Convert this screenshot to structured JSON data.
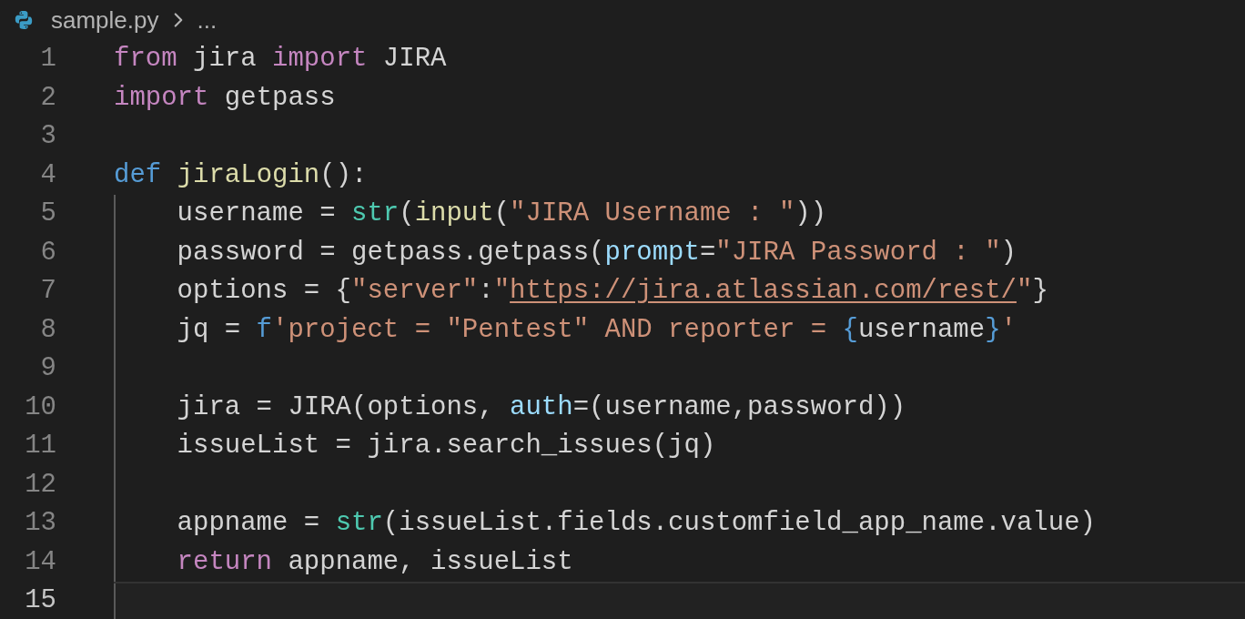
{
  "breadcrumb": {
    "file": "sample.py",
    "more": "..."
  },
  "lines": [
    {
      "number": "1",
      "indented": false,
      "current": false,
      "tokens": [
        {
          "kind": "keyword",
          "text": "from"
        },
        {
          "kind": "plain",
          "text": " jira "
        },
        {
          "kind": "keyword",
          "text": "import"
        },
        {
          "kind": "plain",
          "text": " JIRA"
        }
      ]
    },
    {
      "number": "2",
      "indented": false,
      "current": false,
      "tokens": [
        {
          "kind": "keyword",
          "text": "import"
        },
        {
          "kind": "plain",
          "text": " getpass"
        }
      ]
    },
    {
      "number": "3",
      "indented": false,
      "current": false
    },
    {
      "number": "4",
      "indented": false,
      "current": false,
      "tokens": [
        {
          "kind": "storage",
          "text": "def "
        },
        {
          "kind": "function",
          "text": "jiraLogin"
        },
        {
          "kind": "plain",
          "text": "():"
        }
      ]
    },
    {
      "number": "5",
      "indented": true,
      "current": false,
      "tokens": [
        {
          "kind": "plain",
          "text": "username = "
        },
        {
          "kind": "builtin",
          "text": "str"
        },
        {
          "kind": "plain",
          "text": "("
        },
        {
          "kind": "function",
          "text": "input"
        },
        {
          "kind": "plain",
          "text": "("
        },
        {
          "kind": "string",
          "text": "\"JIRA Username : \""
        },
        {
          "kind": "plain",
          "text": "))"
        }
      ]
    },
    {
      "number": "6",
      "indented": true,
      "current": false,
      "tokens": [
        {
          "kind": "plain",
          "text": "password = getpass.getpass("
        },
        {
          "kind": "param",
          "text": "prompt"
        },
        {
          "kind": "plain",
          "text": "="
        },
        {
          "kind": "string",
          "text": "\"JIRA Password : \""
        },
        {
          "kind": "plain",
          "text": ")"
        }
      ]
    },
    {
      "number": "7",
      "indented": true,
      "current": false,
      "tokens": [
        {
          "kind": "plain",
          "text": "options = {"
        },
        {
          "kind": "string",
          "text": "\"server\""
        },
        {
          "kind": "plain",
          "text": ":"
        },
        {
          "kind": "string",
          "text": "\""
        },
        {
          "kind": "link",
          "text": "https://jira.atlassian.com/rest/"
        },
        {
          "kind": "string",
          "text": "\""
        },
        {
          "kind": "plain",
          "text": "}"
        }
      ]
    },
    {
      "number": "8",
      "indented": true,
      "current": false,
      "tokens": [
        {
          "kind": "plain",
          "text": "jq = "
        },
        {
          "kind": "storage",
          "text": "f"
        },
        {
          "kind": "string",
          "text": "'project = \"Pentest\" AND reporter = "
        },
        {
          "kind": "storage",
          "text": "{"
        },
        {
          "kind": "plain",
          "text": "username"
        },
        {
          "kind": "storage",
          "text": "}"
        },
        {
          "kind": "string",
          "text": "'"
        }
      ]
    },
    {
      "number": "9",
      "indented": true,
      "current": false
    },
    {
      "number": "10",
      "indented": true,
      "current": false,
      "tokens": [
        {
          "kind": "plain",
          "text": "jira = JIRA(options, "
        },
        {
          "kind": "param",
          "text": "auth"
        },
        {
          "kind": "plain",
          "text": "=(username,password))"
        }
      ]
    },
    {
      "number": "11",
      "indented": true,
      "current": false,
      "tokens": [
        {
          "kind": "plain",
          "text": "issueList = jira.search_issues(jq)"
        }
      ]
    },
    {
      "number": "12",
      "indented": true,
      "current": false
    },
    {
      "number": "13",
      "indented": true,
      "current": false,
      "tokens": [
        {
          "kind": "plain",
          "text": "appname = "
        },
        {
          "kind": "builtin",
          "text": "str"
        },
        {
          "kind": "plain",
          "text": "(issueList.fields.customfield_app_name.value)"
        }
      ]
    },
    {
      "number": "14",
      "indented": true,
      "current": false,
      "tokens": [
        {
          "kind": "keyword",
          "text": "return"
        },
        {
          "kind": "plain",
          "text": " appname, issueList"
        }
      ]
    },
    {
      "number": "15",
      "indented": true,
      "current": true
    }
  ]
}
